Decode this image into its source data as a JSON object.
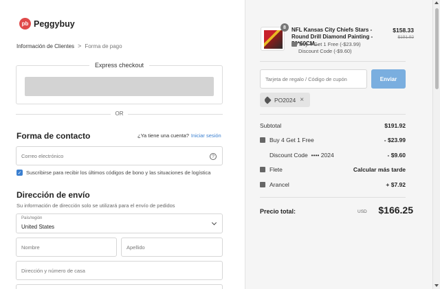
{
  "brand": {
    "logo_mark": "pb",
    "name": "Peggybuy"
  },
  "breadcrumb": {
    "step1": "Información de Clientes",
    "separator": ">",
    "step2": "Forma de pago"
  },
  "express": {
    "title": "Express checkout"
  },
  "divider_or": "OR",
  "contact": {
    "title": "Forma de contacto",
    "login_prompt": "¿Ya tiene una cuenta?",
    "login_link": "Iniciar sesión",
    "email_placeholder": "Correo electrónico",
    "help_icon": "?",
    "subscribe_checked": true,
    "subscribe_text": "Suscribirse para recibir los últimos códigos de bono y las situaciones de logística"
  },
  "shipping": {
    "title": "Dirección de envío",
    "subtitle": "Su información de dirección solo se utilizará para el envío de pedidos",
    "country_label": "País/región",
    "country_value": "United States",
    "first_name_placeholder": "Nombre",
    "last_name_placeholder": "Apellido",
    "address_placeholder": "Dirección y número de casa"
  },
  "summary": {
    "product": {
      "quantity": "8",
      "name": "NFL Kansas City Chiefs Stars - Round Drill Diamond Painting - 50*60CM...",
      "price": "$158.33",
      "original_price": "$191.92",
      "promo": "Buy 4 Get 1 Free (-$23.99)",
      "discount": "Discount Code (-$9.60)"
    },
    "coupon_placeholder": "Tarjeta de regalo / Código de cupón",
    "apply_button": "Enviar",
    "applied_code": "PO2024",
    "remove_icon": "×",
    "subtotal_label": "Subtotal",
    "subtotal_value": "$191.92",
    "promo_label": "Buy 4 Get 1 Free",
    "promo_value": "- $23.99",
    "discount_label": "Discount Code",
    "discount_code_masked": "•••• 2024",
    "discount_value": "- $9.60",
    "shipping_label": "Flete",
    "shipping_value": "Calcular más tarde",
    "tax_label": "Arancel",
    "tax_value": "+ $7.92",
    "total_label": "Precio total:",
    "total_currency": "USD",
    "total_value": "$166.25"
  },
  "colors": {
    "accent": "#3a7fd0",
    "button_disabled": "#7aaedf",
    "brand": "#e04a4a"
  }
}
